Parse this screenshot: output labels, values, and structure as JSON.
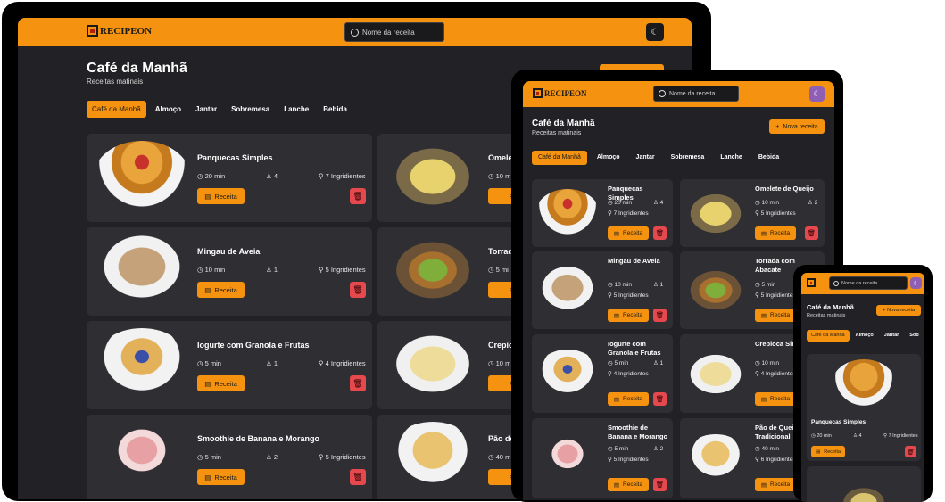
{
  "brand": "RECIPEON",
  "search_placeholder": "Nome da receita",
  "page_title": "Café da Manhã",
  "page_subtitle": "Receitas matinais",
  "new_recipe_label": "Nova receita",
  "tabs": [
    "Café da Manhã",
    "Almoço",
    "Jantar",
    "Sobremesa",
    "Lanche",
    "Bebida"
  ],
  "tabs_mobile": [
    "Café da Manhã",
    "Almoço",
    "Jantar",
    "Sob"
  ],
  "recipe_button": "Receita",
  "recipes": [
    {
      "name": "Panquecas Simples",
      "time": "20 min",
      "servings": "4",
      "ingredients": "7 Ingridientes"
    },
    {
      "name": "Omelete de Queijo",
      "time": "10 min",
      "servings": "2",
      "ingredients": "5 Ingridientes"
    },
    {
      "name": "Mingau de Aveia",
      "time": "10 min",
      "servings": "1",
      "ingredients": "5 Ingridientes"
    },
    {
      "name": "Torrada com Abacate",
      "time": "5 min",
      "servings": "1",
      "ingredients": "5 Ingridientes"
    },
    {
      "name": "Iogurte com Granola e Frutas",
      "time": "5 min",
      "servings": "1",
      "ingredients": "4 Ingridientes"
    },
    {
      "name": "Crepioca Simples",
      "time": "10 min",
      "servings": "1",
      "ingredients": "4 Ingridientes"
    },
    {
      "name": "Smoothie de Banana e Morango",
      "time": "5 min",
      "servings": "2",
      "ingredients": "5 Ingridientes"
    },
    {
      "name": "Pão de Queijo Tradicional",
      "time": "40 min",
      "servings": "6",
      "ingredients": "6 Ingridientes"
    }
  ],
  "desktop_right_titles": [
    "Omele",
    "Torrad",
    "Crepio",
    "Pão de"
  ],
  "desktop_right_times": [
    "10 m",
    "5 mi",
    "10 m",
    "40 m"
  ],
  "desktop_right_btn": "R",
  "tablet_right_titles": [
    "Omelete de Queijo",
    "Torrada com Abacate",
    "Crepioca Sim",
    "Pão de Queij Tradicional"
  ],
  "colors": {
    "accent": "#f5920f",
    "bg": "#222226",
    "card": "#2e2e33",
    "delete": "#e5484d"
  },
  "icons": [
    "search-icon",
    "moon-icon",
    "clock-icon",
    "user-icon",
    "ingredients-icon",
    "receipt-icon",
    "trash-icon",
    "plus-icon"
  ]
}
